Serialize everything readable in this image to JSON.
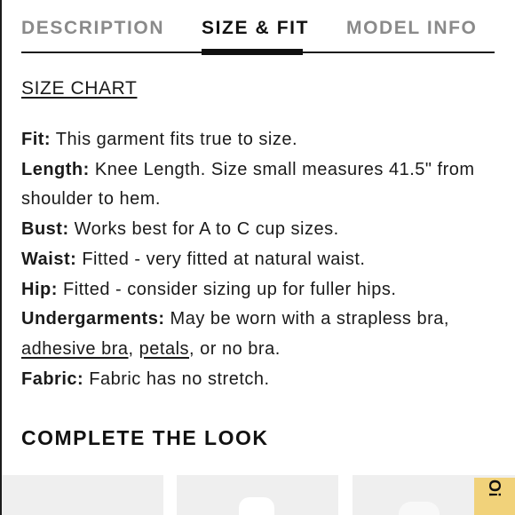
{
  "tabs": [
    {
      "label": "DESCRIPTION",
      "active": false
    },
    {
      "label": "SIZE & FIT",
      "active": true
    },
    {
      "label": "MODEL INFO",
      "active": false
    }
  ],
  "size_chart_link": "SIZE CHART",
  "specs": {
    "fit": {
      "label": "Fit:",
      "text": " This garment fits true to size."
    },
    "length": {
      "label": "Length:",
      "text": " Knee Length. Size small measures 41.5\" from shoulder to hem."
    },
    "bust": {
      "label": "Bust:",
      "text": " Works best for A to C cup sizes."
    },
    "waist": {
      "label": "Waist:",
      "text": " Fitted - very fitted at natural waist."
    },
    "hip": {
      "label": "Hip:",
      "text": " Fitted - consider sizing up for fuller hips."
    },
    "undergarments": {
      "label": "Undergarments:",
      "text": " May be worn with a strapless bra, ",
      "link_1": "adhesive bra",
      "sep": ", ",
      "link_2": "petals",
      "tail": ", or no bra."
    },
    "fabric": {
      "label": "Fabric:",
      "text": " Fabric has no stretch."
    }
  },
  "complete_the_look": {
    "title": "COMPLETE THE LOOK",
    "badge_text": "!O",
    "badge_color": "#f1d27a"
  }
}
